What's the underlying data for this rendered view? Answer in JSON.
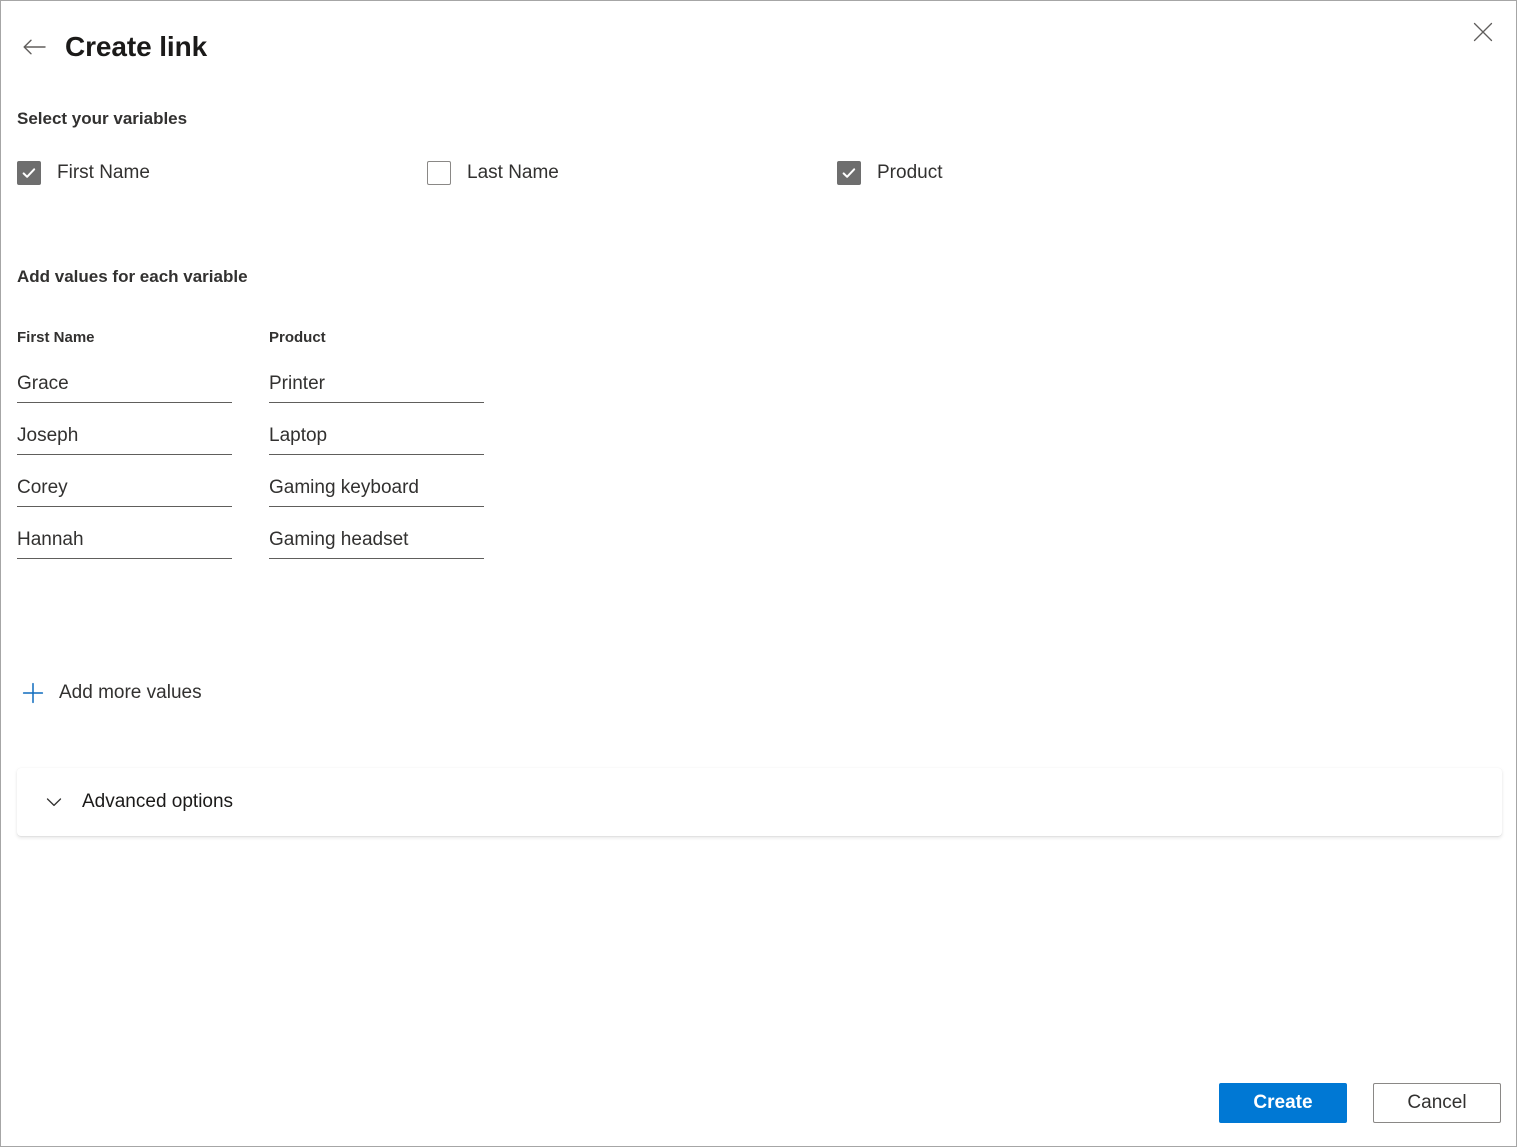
{
  "header": {
    "title": "Create link",
    "back_icon": "arrow-left-icon",
    "close_icon": "close-icon"
  },
  "variables_section": {
    "heading": "Select your variables",
    "items": [
      {
        "label": "First Name",
        "checked": true
      },
      {
        "label": "Last Name",
        "checked": false
      },
      {
        "label": "Product",
        "checked": true
      }
    ]
  },
  "values_section": {
    "heading": "Add values for each variable",
    "columns": [
      "First Name",
      "Product"
    ],
    "rows": [
      [
        "Grace",
        "Printer"
      ],
      [
        "Joseph",
        "Laptop"
      ],
      [
        "Corey",
        "Gaming keyboard"
      ],
      [
        "Hannah",
        "Gaming headset"
      ]
    ],
    "add_more_label": "Add more values",
    "add_more_icon": "plus-icon",
    "add_more_icon_color": "#0f6cbd"
  },
  "advanced": {
    "label": "Advanced options",
    "chevron_icon": "chevron-down-icon",
    "expanded": false
  },
  "footer": {
    "create_label": "Create",
    "cancel_label": "Cancel",
    "primary_color": "#0078d4"
  }
}
